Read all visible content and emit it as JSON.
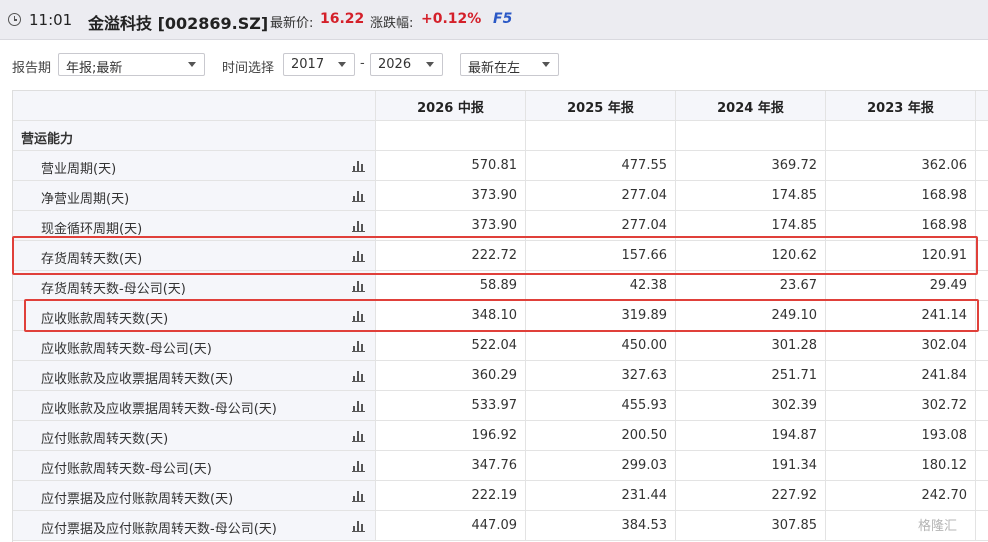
{
  "header": {
    "time": "11:01",
    "title": "金溢科技 [002869.SZ]",
    "price_label": "最新价:",
    "price": "16.22",
    "change_label": "涨跌幅:",
    "change": "+0.12%",
    "hotkey": "F5",
    "accent_color": "#d4202a"
  },
  "filters": {
    "report_period_label": "报告期",
    "report_period_value": "年报;最新",
    "time_label": "时间选择",
    "year_from": "2017",
    "separator": "-",
    "year_to": "2026",
    "order_value": "最新在左"
  },
  "table": {
    "columns": [
      "2026 中报",
      "2025 年报",
      "2024 年报",
      "2023 年报"
    ],
    "section": "营运能力",
    "rows": [
      {
        "label": "营业周期(天)",
        "values": [
          "570.81",
          "477.55",
          "369.72",
          "362.06"
        ]
      },
      {
        "label": "净营业周期(天)",
        "values": [
          "373.90",
          "277.04",
          "174.85",
          "168.98"
        ]
      },
      {
        "label": "现金循环周期(天)",
        "values": [
          "373.90",
          "277.04",
          "174.85",
          "168.98"
        ]
      },
      {
        "label": "存货周转天数(天)",
        "values": [
          "222.72",
          "157.66",
          "120.62",
          "120.91"
        ]
      },
      {
        "label": "存货周转天数-母公司(天)",
        "values": [
          "58.89",
          "42.38",
          "23.67",
          "29.49"
        ]
      },
      {
        "label": "应收账款周转天数(天)",
        "values": [
          "348.10",
          "319.89",
          "249.10",
          "241.14"
        ]
      },
      {
        "label": "应收账款周转天数-母公司(天)",
        "values": [
          "522.04",
          "450.00",
          "301.28",
          "302.04"
        ]
      },
      {
        "label": "应收账款及应收票据周转天数(天)",
        "values": [
          "360.29",
          "327.63",
          "251.71",
          "241.84"
        ]
      },
      {
        "label": "应收账款及应收票据周转天数-母公司(天)",
        "values": [
          "533.97",
          "455.93",
          "302.39",
          "302.72"
        ]
      },
      {
        "label": "应付账款周转天数(天)",
        "values": [
          "196.92",
          "200.50",
          "194.87",
          "193.08"
        ]
      },
      {
        "label": "应付账款周转天数-母公司(天)",
        "values": [
          "347.76",
          "299.03",
          "191.34",
          "180.12"
        ]
      },
      {
        "label": "应付票据及应付账款周转天数(天)",
        "values": [
          "222.19",
          "231.44",
          "227.92",
          "242.70"
        ]
      },
      {
        "label": "应付票据及应付账款周转天数-母公司(天)",
        "values": [
          "447.09",
          "384.53",
          "307.85",
          ""
        ]
      }
    ],
    "highlight_color": "#e0403a"
  },
  "watermark": "格隆汇"
}
